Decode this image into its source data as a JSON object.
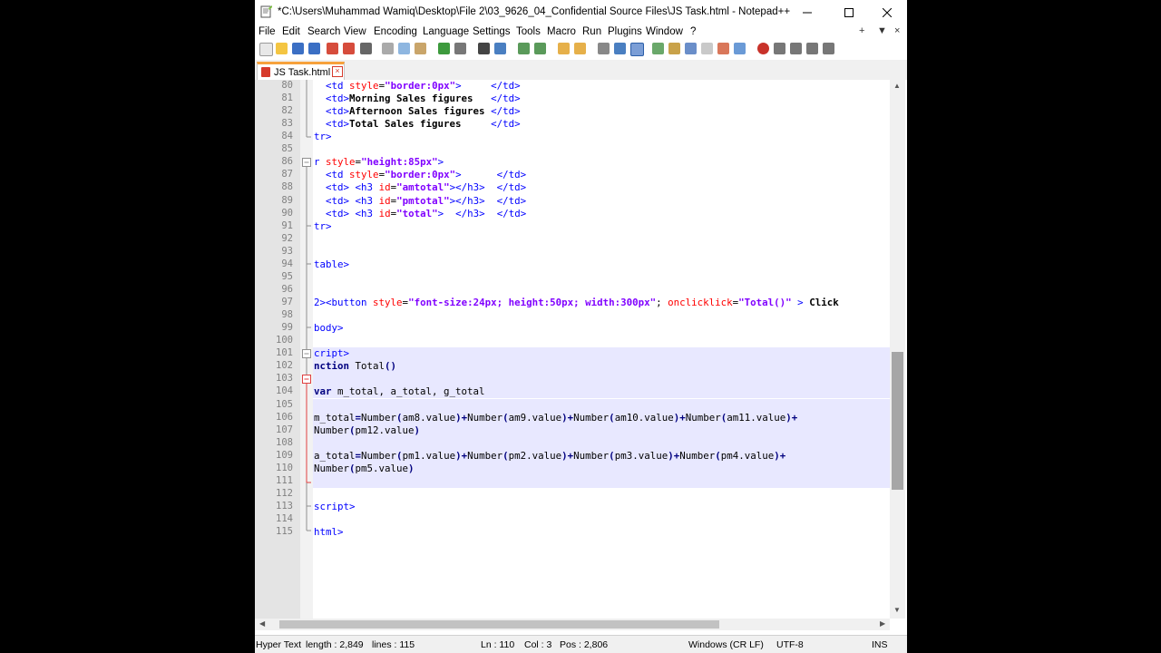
{
  "window": {
    "title": "*C:\\Users\\Muhammad Wamiq\\Desktop\\File 2\\03_9626_04_Confidential Source Files\\JS Task.html - Notepad++"
  },
  "menu": [
    "File",
    "Edit",
    "Search",
    "View",
    "Encoding",
    "Language",
    "Settings",
    "Tools",
    "Macro",
    "Run",
    "Plugins",
    "Window",
    "?"
  ],
  "menu_controls": [
    "+",
    "▼",
    "×"
  ],
  "tab": {
    "label": "JS Task.html"
  },
  "lines": [
    {
      "n": "80",
      "html": "  <span class='tag'>&lt;td</span> <span class='attr'>style</span>=<span class='str'>\"border:0px\"</span><span class='tag'>&gt;</span>     <span class='tag'>&lt;/td&gt;</span>"
    },
    {
      "n": "81",
      "html": "  <span class='tag'>&lt;td&gt;</span><span class='bold'>Morning Sales figures</span>   <span class='tag'>&lt;/td&gt;</span>"
    },
    {
      "n": "82",
      "html": "  <span class='tag'>&lt;td&gt;</span><span class='bold'>Afternoon Sales figures</span> <span class='tag'>&lt;/td&gt;</span>"
    },
    {
      "n": "83",
      "html": "  <span class='tag'>&lt;td&gt;</span><span class='bold'>Total Sales figures</span>     <span class='tag'>&lt;/td&gt;</span>"
    },
    {
      "n": "84",
      "html": "<span class='tag'>tr&gt;</span>"
    },
    {
      "n": "85",
      "html": ""
    },
    {
      "n": "86",
      "html": "<span class='tag'>r</span> <span class='attr'>style</span>=<span class='str'>\"height:85px\"</span><span class='tag'>&gt;</span>"
    },
    {
      "n": "87",
      "html": "  <span class='tag'>&lt;td</span> <span class='attr'>style</span>=<span class='str'>\"border:0px\"</span><span class='tag'>&gt;</span>      <span class='tag'>&lt;/td&gt;</span>"
    },
    {
      "n": "88",
      "html": "  <span class='tag'>&lt;td&gt;</span> <span class='tag'>&lt;h3</span> <span class='attr'>id</span>=<span class='str'>\"amtotal\"</span><span class='tag'>&gt;&lt;/h3&gt;</span>  <span class='tag'>&lt;/td&gt;</span>"
    },
    {
      "n": "89",
      "html": "  <span class='tag'>&lt;td&gt;</span> <span class='tag'>&lt;h3</span> <span class='attr'>id</span>=<span class='str'>\"pmtotal\"</span><span class='tag'>&gt;&lt;/h3&gt;</span>  <span class='tag'>&lt;/td&gt;</span>"
    },
    {
      "n": "90",
      "html": "  <span class='tag'>&lt;td&gt;</span> <span class='tag'>&lt;h3</span> <span class='attr'>id</span>=<span class='str'>\"total\"</span><span class='tag'>&gt;</span>  <span class='tag'>&lt;/h3&gt;</span>  <span class='tag'>&lt;/td&gt;</span>"
    },
    {
      "n": "91",
      "html": "<span class='tag'>tr&gt;</span>"
    },
    {
      "n": "92",
      "html": ""
    },
    {
      "n": "93",
      "html": ""
    },
    {
      "n": "94",
      "html": "<span class='tag'>table&gt;</span>"
    },
    {
      "n": "95",
      "html": ""
    },
    {
      "n": "96",
      "html": ""
    },
    {
      "n": "97",
      "html": "<span class='tag'>2&gt;&lt;button</span> <span class='attr'>style</span>=<span class='str'>\"font-size:24px; height:50px; width:300px\"</span>; <span class='attr'>onclicklick</span>=<span class='str'>\"Total()\"</span> <span class='tag'>&gt;</span> <span class='bold'>Click</span>"
    },
    {
      "n": "98",
      "html": ""
    },
    {
      "n": "99",
      "html": "<span class='tag'>body&gt;</span>"
    },
    {
      "n": "100",
      "html": ""
    },
    {
      "n": "101",
      "html": "<span class='tag'>cript&gt;</span>"
    },
    {
      "n": "102",
      "html": "<span class='kw'>nction</span> Total<span class='op'>()</span>"
    },
    {
      "n": "103",
      "html": ""
    },
    {
      "n": "104",
      "html": "<span class='kw'>var</span> m_total, a_total, g_total"
    },
    {
      "n": "105",
      "html": ""
    },
    {
      "n": "106",
      "html": "m_total<span class='op'>=</span>Number<span class='op'>(</span>am8.value<span class='op'>)+</span>Number<span class='op'>(</span>am9.value<span class='op'>)+</span>Number<span class='op'>(</span>am10.value<span class='op'>)+</span>Number<span class='op'>(</span>am11.value<span class='op'>)+</span>"
    },
    {
      "n": "107",
      "html": "Number<span class='op'>(</span>pm12.value<span class='op'>)</span>"
    },
    {
      "n": "108",
      "html": ""
    },
    {
      "n": "109",
      "html": "a_total<span class='op'>=</span>Number<span class='op'>(</span>pm1.value<span class='op'>)+</span>Number<span class='op'>(</span>pm2.value<span class='op'>)+</span>Number<span class='op'>(</span>pm3.value<span class='op'>)+</span>Number<span class='op'>(</span>pm4.value<span class='op'>)+</span>"
    },
    {
      "n": "110",
      "html": "Number<span class='op'>(</span>pm5.value<span class='op'>)</span>"
    },
    {
      "n": "111",
      "html": ""
    },
    {
      "n": "112",
      "html": ""
    },
    {
      "n": "113",
      "html": "<span class='tag'>script&gt;</span>"
    },
    {
      "n": "114",
      "html": ""
    },
    {
      "n": "115",
      "html": "<span class='tag'>html&gt;</span>"
    }
  ],
  "status": {
    "lang": "Hyper Text",
    "length": "length : 2,849",
    "lines": "lines : 115",
    "ln": "Ln : 110",
    "col": "Col : 3",
    "pos": "Pos : 2,806",
    "eol": "Windows (CR LF)",
    "enc": "UTF-8",
    "mode": "INS"
  },
  "colors": {
    "tag": "#0000ff",
    "attr": "#ff0000",
    "string": "#8000ff",
    "keyword": "#000080",
    "tab_accent": "#f7a13c"
  }
}
